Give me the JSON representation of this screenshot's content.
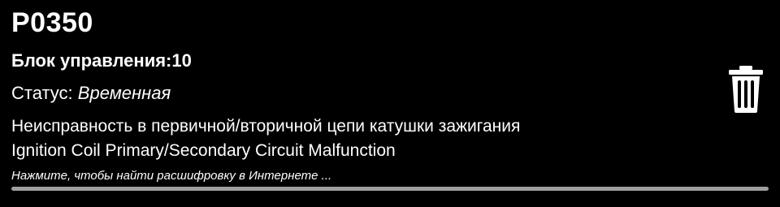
{
  "dtc": {
    "code": "P0350",
    "module_label": "Блок управления:10",
    "status_label": "Статус:",
    "status_value": "Временная",
    "description_ru": "Неисправность в первичной/вторичной цепи катушки зажигания",
    "description_en": "Ignition Coil Primary/Secondary Circuit Malfunction",
    "hint": "Нажмите, чтобы найти расшифровку в Интернете ..."
  },
  "icons": {
    "delete": "trash-icon"
  },
  "colors": {
    "background": "#000000",
    "text": "#ffffff",
    "divider": "#9e9e9e"
  }
}
